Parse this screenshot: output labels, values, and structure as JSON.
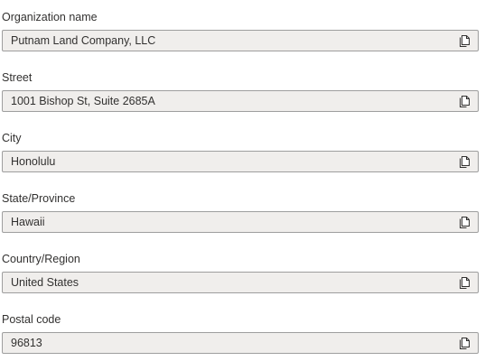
{
  "fields": [
    {
      "label": "Organization name",
      "value": "Putnam Land Company, LLC",
      "action_icon": "copy-icon"
    },
    {
      "label": "Street",
      "value": "1001 Bishop St, Suite 2685A",
      "action_icon": "copy-icon"
    },
    {
      "label": "City",
      "value": "Honolulu",
      "action_icon": "copy-icon"
    },
    {
      "label": "State/Province",
      "value": "Hawaii",
      "action_icon": "copy-icon"
    },
    {
      "label": "Country/Region",
      "value": "United States",
      "action_icon": "copy-icon"
    },
    {
      "label": "Postal code",
      "value": "96813",
      "action_icon": "copy-icon"
    }
  ],
  "colors": {
    "field_background": "#f0eeec",
    "field_border": "#9e9e9e",
    "text": "#323130"
  }
}
